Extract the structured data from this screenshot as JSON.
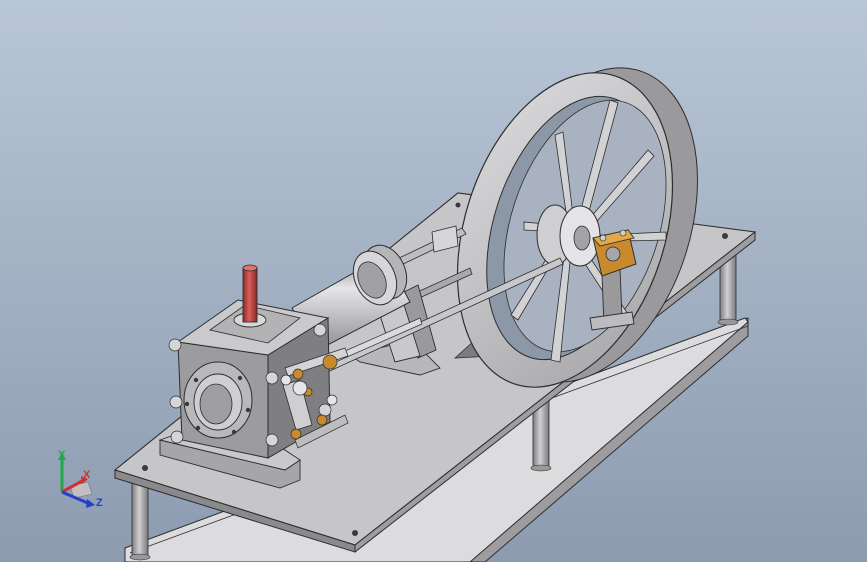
{
  "colors": {
    "background_top": "#b4c2d3",
    "background_bottom": "#8b9bb0",
    "part_gray": "#b9b9bb",
    "part_dark": "#6f6f72",
    "edge": "#2d2d2f",
    "brass": "#c98a2e",
    "red": "#c0403e",
    "axis_x": "#d03030",
    "axis_y": "#22a84a",
    "axis_z": "#2540c8"
  },
  "view_triad": {
    "x_label": "X",
    "y_label": "Y",
    "z_label": "Z"
  }
}
